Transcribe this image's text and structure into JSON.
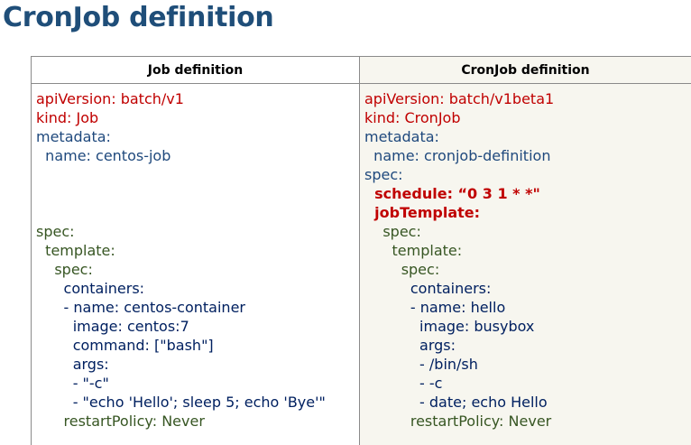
{
  "page": {
    "title": "CronJob definition"
  },
  "table": {
    "headers": {
      "left": "Job definition",
      "right": "CronJob definition"
    },
    "left_lines": [
      {
        "text": "apiVersion: batch/v1",
        "color": "red"
      },
      {
        "text": "kind: Job",
        "color": "red"
      },
      {
        "text": "metadata:",
        "color": "blue"
      },
      {
        "text": "  name: centos-job",
        "color": "blue"
      },
      {
        "text": "",
        "color": "blue"
      },
      {
        "text": "",
        "color": "blue"
      },
      {
        "text": "",
        "color": "blue"
      },
      {
        "text": "spec:",
        "color": "green"
      },
      {
        "text": "  template:",
        "color": "green"
      },
      {
        "text": "    spec:",
        "color": "green"
      },
      {
        "text": "      containers:",
        "color": "navy"
      },
      {
        "text": "      - name: centos-container",
        "color": "navy"
      },
      {
        "text": "        image: centos:7",
        "color": "navy"
      },
      {
        "text": "        command: [\"bash\"]",
        "color": "navy"
      },
      {
        "text": "        args:",
        "color": "navy"
      },
      {
        "text": "        - \"-c\"",
        "color": "navy"
      },
      {
        "text": "        - \"echo 'Hello'; sleep 5; echo 'Bye'\"",
        "color": "navy"
      },
      {
        "text": "      restartPolicy: Never",
        "color": "green"
      }
    ],
    "right_lines": [
      {
        "text": "apiVersion: batch/v1beta1",
        "color": "red"
      },
      {
        "text": "kind: CronJob",
        "color": "red"
      },
      {
        "text": "metadata:",
        "color": "blue"
      },
      {
        "text": "  name: cronjob-definition",
        "color": "blue"
      },
      {
        "text": "spec:",
        "color": "blue"
      },
      {
        "text": "  schedule: “0 3 1 * *\"",
        "color": "boldred"
      },
      {
        "text": "  jobTemplate:",
        "color": "boldred"
      },
      {
        "text": "    spec:",
        "color": "green"
      },
      {
        "text": "      template:",
        "color": "green"
      },
      {
        "text": "        spec:",
        "color": "green"
      },
      {
        "text": "          containers:",
        "color": "navy"
      },
      {
        "text": "          - name: hello",
        "color": "navy"
      },
      {
        "text": "            image: busybox",
        "color": "navy"
      },
      {
        "text": "            args:",
        "color": "navy"
      },
      {
        "text": "            - /bin/sh",
        "color": "navy"
      },
      {
        "text": "            - -c",
        "color": "navy"
      },
      {
        "text": "            - date; echo Hello",
        "color": "navy"
      },
      {
        "text": "          restartPolicy: Never",
        "color": "green"
      }
    ]
  }
}
